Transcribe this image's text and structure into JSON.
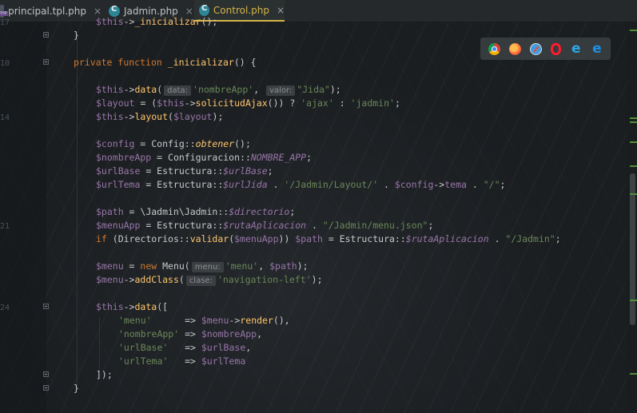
{
  "tabs": [
    {
      "label": "principal.tpl.php",
      "icon": "php-template-file-icon",
      "close": "×"
    },
    {
      "label": "Jadmin.php",
      "icon": "php-class-file-icon",
      "close": "×"
    },
    {
      "label": "Control.php",
      "icon": "php-class-file-icon",
      "close": "×",
      "active": true
    }
  ],
  "gutter": {
    "line_numbers": [
      "17",
      "",
      "",
      "10",
      "",
      "",
      "",
      "",
      "14",
      "",
      "",
      "",
      "",
      "",
      "",
      "",
      "",
      "",
      "21",
      "",
      "",
      "",
      "",
      "",
      "24",
      "",
      "",
      "",
      "",
      "",
      "",
      "",
      "",
      "",
      "",
      "",
      "",
      "",
      "",
      "",
      "",
      "",
      "",
      "",
      "",
      "",
      "",
      "",
      "",
      "",
      "",
      "",
      ""
    ]
  },
  "code": {
    "line_top_cut": "$this->_inicializar();",
    "close_brace": "}",
    "private_kw": "private",
    "function_kw": "function",
    "func_name": "_inicializar",
    "func_sig_rest": "() {",
    "hint_datos": "data:",
    "hint_valor": "valor:",
    "hint_menu": "menu:",
    "hint_clase": "clase:",
    "str_nombreApp": "'nombreApp'",
    "str_jida": "\"Jida\"",
    "str_ajax": "'ajax'",
    "str_jadmin": "'jadmin'",
    "str_layout_path": "'/Jadmin/Layout/'",
    "str_slash": "\"/\"",
    "str_menu_json": "\"/Jadmin/menu.json\"",
    "str_jadmin_path": "\"/Jadmin\"",
    "str_menu": "'menu'",
    "str_nav_left": "'navigation-left'",
    "str_urlBase": "'urlBase'",
    "str_urlTema": "'urlTema'"
  },
  "browsers": [
    {
      "name": "chrome-icon"
    },
    {
      "name": "firefox-icon"
    },
    {
      "name": "safari-icon"
    },
    {
      "name": "opera-icon"
    },
    {
      "name": "internet-explorer-icon",
      "glyph": "e"
    },
    {
      "name": "edge-icon",
      "glyph": "e"
    }
  ]
}
